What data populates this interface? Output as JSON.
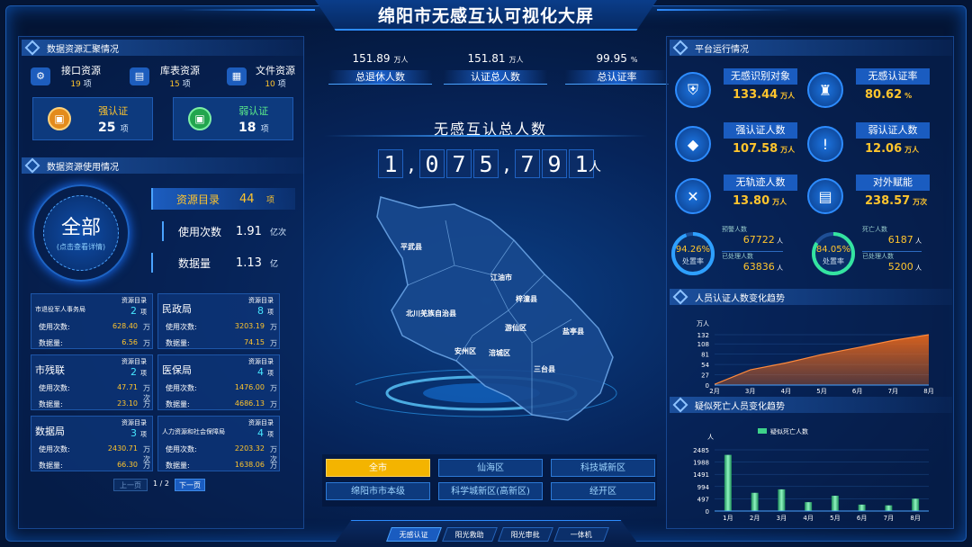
{
  "title": "绵阳市无感互认可视化大屏",
  "left": {
    "summary": {
      "section_title": "数据资源汇聚情况",
      "resources": [
        {
          "icon": "api-icon",
          "label": "接口资源",
          "value": "19",
          "unit": "项"
        },
        {
          "icon": "database-icon",
          "label": "库表资源",
          "value": "15",
          "unit": "项"
        },
        {
          "icon": "file-icon",
          "label": "文件资源",
          "value": "10",
          "unit": "项"
        }
      ],
      "strong": {
        "label": "强认证",
        "value": "25",
        "unit": "项"
      },
      "weak": {
        "label": "弱认证",
        "value": "18",
        "unit": "项"
      }
    },
    "usage": {
      "section_title": "数据资源使用情况",
      "circle_title": "全部",
      "circle_sub": "(点击查看详情)",
      "rows": [
        {
          "label": "资源目录",
          "value": "44",
          "unit": "项"
        },
        {
          "label": "使用次数",
          "value": "1.91",
          "unit": "亿次"
        },
        {
          "label": "数据量",
          "value": "1.13",
          "unit": "亿"
        }
      ]
    },
    "depts": [
      {
        "name": "市退役军人事务局",
        "dir_label": "资源目录",
        "dir_value": "2",
        "dir_unit": "项",
        "count_label": "使用次数:",
        "count": "628.40",
        "count_unit": "万",
        "volume_label": "数据量:",
        "volume": "6.56",
        "volume_unit": "万"
      },
      {
        "name": "民政局",
        "dir_label": "资源目录",
        "dir_value": "8",
        "dir_unit": "项",
        "count_label": "使用次数:",
        "count": "3203.19",
        "count_unit": "万",
        "volume_label": "数据量:",
        "volume": "74.15",
        "volume_unit": "万"
      },
      {
        "name": "市残联",
        "dir_label": "资源目录",
        "dir_value": "2",
        "dir_unit": "项",
        "count_label": "使用次数:",
        "count": "47.71",
        "count_unit": "万次",
        "volume_label": "数据量:",
        "volume": "23.10",
        "volume_unit": "万"
      },
      {
        "name": "医保局",
        "dir_label": "资源目录",
        "dir_value": "4",
        "dir_unit": "项",
        "count_label": "使用次数:",
        "count": "1476.00",
        "count_unit": "万",
        "volume_label": "数据量:",
        "volume": "4686.13",
        "volume_unit": "万"
      },
      {
        "name": "数据局",
        "dir_label": "资源目录",
        "dir_value": "3",
        "dir_unit": "项",
        "count_label": "使用次数:",
        "count": "2430.71",
        "count_unit": "万次",
        "volume_label": "数据量:",
        "volume": "66.30",
        "volume_unit": "万"
      },
      {
        "name": "人力资源和社会保障局",
        "dir_label": "资源目录",
        "dir_value": "4",
        "dir_unit": "项",
        "count_label": "使用次数:",
        "count": "2203.32",
        "count_unit": "万次",
        "volume_label": "数据量:",
        "volume": "1638.06",
        "volume_unit": "万"
      }
    ],
    "pager": {
      "prev": "上一页",
      "page": "1",
      "total": "/ 2",
      "next": "下一页"
    }
  },
  "center": {
    "stats": [
      {
        "value": "151.89",
        "unit": "万人",
        "label": "总退休人数"
      },
      {
        "value": "151.81",
        "unit": "万人",
        "label": "认证总人数"
      },
      {
        "value": "99.95",
        "unit": "%",
        "label": "总认证率"
      }
    ],
    "total_title": "无感互认总人数",
    "digits": [
      "1",
      ",",
      "0",
      "7",
      "5",
      ",",
      "7",
      "9",
      "1"
    ],
    "total_unit": "人",
    "map_labels": [
      "平武县",
      "江油市",
      "北川羌族自治县",
      "梓潼县",
      "游仙区",
      "盐亭县",
      "安州区",
      "涪城区",
      "三台县"
    ],
    "districts": [
      "全市",
      "仙海区",
      "科技城新区",
      "绵阳市市本级",
      "科学城新区(高新区)",
      "经开区"
    ],
    "nav": [
      "无感认证",
      "阳光救助",
      "阳光审批",
      "一体机"
    ]
  },
  "right": {
    "section_title": "平台运行情况",
    "metrics": [
      {
        "icon": "shield-user-icon",
        "label": "无感识别对象",
        "value": "133.44",
        "unit": "万人"
      },
      {
        "icon": "stamp-icon",
        "label": "无感认证率",
        "value": "80.62",
        "unit": "%"
      },
      {
        "icon": "diamond-icon",
        "label": "强认证人数",
        "value": "107.58",
        "unit": "万人"
      },
      {
        "icon": "shield-alert-icon",
        "label": "弱认证人数",
        "value": "12.06",
        "unit": "万人"
      },
      {
        "icon": "close-circle-icon",
        "label": "无轨迹人数",
        "value": "13.80",
        "unit": "万人"
      },
      {
        "icon": "document-icon",
        "label": "对外赋能",
        "value": "238.57",
        "unit": "万次"
      }
    ],
    "warn": {
      "pct": "94.26%",
      "sub": "处置率",
      "fill": 0.9426,
      "l1": "预警人数",
      "v1": "67722",
      "u1": "人",
      "l2": "已处理人数",
      "v2": "63836",
      "u2": "人"
    },
    "death": {
      "pct": "84.05%",
      "sub": "处置率",
      "fill": 0.8405,
      "l1": "死亡人数",
      "v1": "6187",
      "u1": "人",
      "l2": "已处理人数",
      "v2": "5200",
      "u2": "人"
    },
    "trend_title": "人员认证人数变化趋势",
    "bar_title": "疑似死亡人员变化趋势",
    "colors": {
      "area": "#e0641c",
      "bar": "#3ed28a"
    }
  },
  "chart_data": [
    {
      "type": "area",
      "title": "人员认证人数变化趋势",
      "ylabel": "万人",
      "categories": [
        "2月",
        "3月",
        "4月",
        "5月",
        "6月",
        "7月",
        "8月"
      ],
      "ylim": [
        0,
        132
      ],
      "yticks": [
        0,
        27,
        54,
        81,
        108,
        132
      ],
      "values": [
        2,
        40,
        58,
        80,
        98,
        117,
        132
      ]
    },
    {
      "type": "bar",
      "title": "疑似死亡人员变化趋势",
      "ylabel": "人",
      "legend": "疑似死亡人数",
      "categories": [
        "1月",
        "2月",
        "3月",
        "4月",
        "5月",
        "6月",
        "7月",
        "8月"
      ],
      "ylim": [
        0,
        2485
      ],
      "yticks": [
        0,
        497,
        994,
        1491,
        1988,
        2485
      ],
      "values": [
        2280,
        740,
        880,
        360,
        620,
        260,
        230,
        500
      ]
    }
  ]
}
